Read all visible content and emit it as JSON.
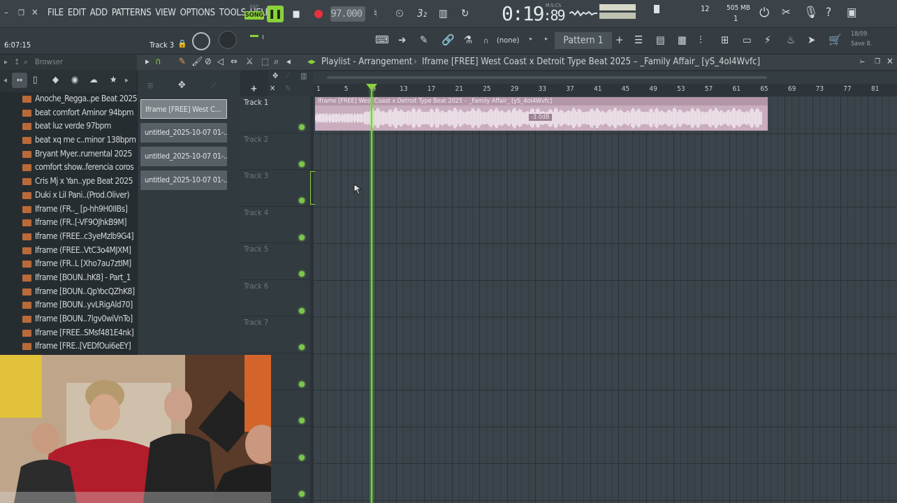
{
  "menu": [
    "FILE",
    "EDIT",
    "ADD",
    "PATTERNS",
    "VIEW",
    "OPTIONS",
    "TOOLS",
    "HELP"
  ],
  "transport": {
    "pat_label": "PAT",
    "song_label": "SONG",
    "tempo": "97.000",
    "time_main": "0:19",
    "time_sub": ":89",
    "time_format": "M:S:CS",
    "cpu_value": "12",
    "memory": "505 MB",
    "polyphony": "1"
  },
  "hint_bar": {
    "position": "6:07:15",
    "track_label": "Track 3"
  },
  "toolbar": {
    "channel_target": "(none)",
    "pattern_name": "Pattern 1",
    "date": "18/09",
    "save_label": "Save 8."
  },
  "browser": {
    "title": "Browser",
    "items": [
      "Anoche_Regga..pe Beat 2025",
      "beat comfort Aminor 94bpm",
      "beat luz verde 97bpm",
      "beat xq me c..minor 138bpm",
      "Bryant Myer..rumental 2025",
      "comfort show..ferencia coros",
      "Cris Mj x Yan..ype Beat 2025",
      "Duki x Lil Pani..(Prod.Oliver)",
      "Iframe (FR.._ [p-hh9H0IIBs]",
      "Iframe (FR..[-VF9OJhkB9M]",
      "Iframe (FREE..c3yeMzlb9G4]",
      "Iframe (FREE..VtC3o4MJXM]",
      "Iframe (FR..L [Xho7au7ztIM]",
      "Iframe [BOUN..hK8] - Part_1",
      "Iframe [BOUN..QpYocQZhK8]",
      "Iframe [BOUN..yvLRigAld70]",
      "Iframe [BOUN..7lgv0wiVnTo]",
      "Iframe [FREE..SMsf481E4nk]",
      "Iframe [FRE..[VEDfOui6eEY]"
    ]
  },
  "clips": [
    "Iframe [FREE] West C...",
    "untitled_2025-10-07 01-...",
    "untitled_2025-10-07 01-...",
    "untitled_2025-10-07 01-..."
  ],
  "playlist": {
    "title": "Playlist - Arrangement",
    "breadcrumb": "Iframe [FREE] West Coast x Detroit Type Beat 2025 – _Family Affair_ [yS_4oI4Wvfc]",
    "ruler": [
      "1",
      "5",
      "9",
      "13",
      "17",
      "21",
      "25",
      "29",
      "33",
      "37",
      "41",
      "45",
      "49",
      "53",
      "57",
      "61",
      "65",
      "69",
      "73",
      "77",
      "81"
    ],
    "tracks": [
      "Track 1",
      "Track 2",
      "Track 3",
      "Track 4",
      "Track 5",
      "Track 6",
      "Track 7"
    ],
    "audio_clip_label": "Iframe [FREE] West Coast x Detroit Type Beat 2025 – _Family Affair_ [yS_4oI4Wvfc]",
    "clip_gain": "-3.0dB"
  },
  "colors": {
    "accent_green": "#8bd13c",
    "playhead": "#6bdc2f",
    "audio_clip": "#c9adbe"
  }
}
